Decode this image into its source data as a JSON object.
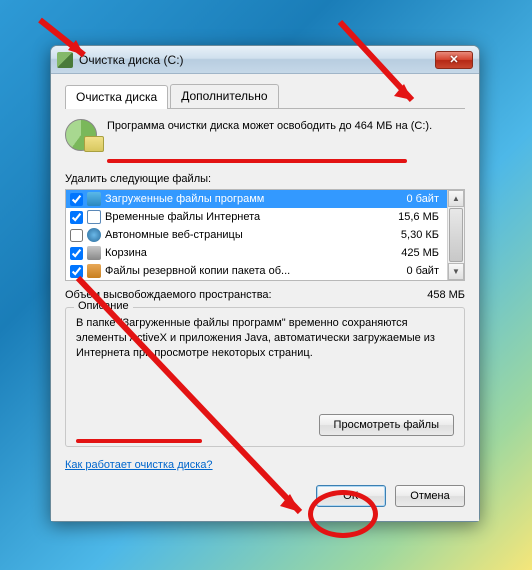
{
  "window": {
    "title": "Очистка диска  (C:)",
    "close_glyph": "✕"
  },
  "tabs": {
    "cleanup": "Очистка диска",
    "more": "Дополнительно"
  },
  "info": {
    "line": "Программа очистки диска может освободить до 464 МБ на  (C:)."
  },
  "list_label": "Удалить следующие файлы:",
  "files": [
    {
      "name": "Загруженные файлы программ",
      "size": "0 байт",
      "selected": true,
      "checked": true,
      "icon": "fi-blue"
    },
    {
      "name": "Временные файлы Интернета",
      "size": "15,6 МБ",
      "selected": false,
      "checked": true,
      "icon": "fi-page"
    },
    {
      "name": "Автономные веб-страницы",
      "size": "5,30 КБ",
      "selected": false,
      "checked": false,
      "icon": "fi-globe"
    },
    {
      "name": "Корзина",
      "size": "425 МБ",
      "selected": false,
      "checked": true,
      "icon": "fi-bin"
    },
    {
      "name": "Файлы резервной копии пакета об...",
      "size": "0 байт",
      "selected": false,
      "checked": true,
      "icon": "fi-gear"
    }
  ],
  "total": {
    "label": "Объем высвобождаемого пространства:",
    "value": "458 МБ"
  },
  "group": {
    "title": "Описание",
    "text": "В папке \"Загруженные файлы программ\" временно сохраняются элементы ActiveX и приложения Java, автоматически загружаемые из Интернета при просмотре некоторых страниц.",
    "view_btn": "Просмотреть файлы"
  },
  "link": "Как работает очистка диска?",
  "buttons": {
    "ok": "ОК",
    "cancel": "Отмена"
  },
  "scroll": {
    "up": "▲",
    "down": "▼"
  }
}
